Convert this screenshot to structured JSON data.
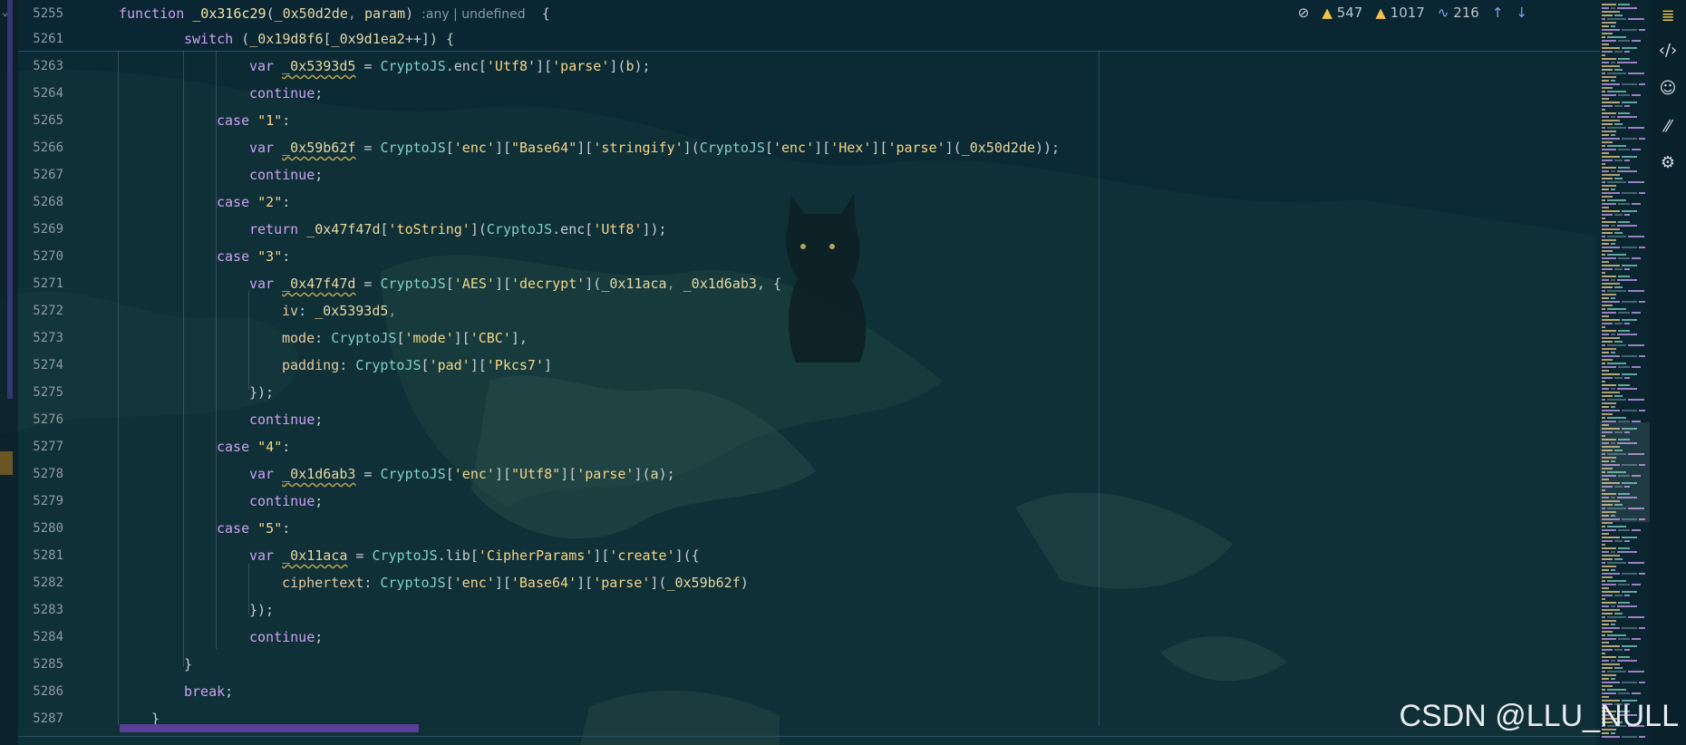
{
  "inlay": {
    "hidden_icon": "eye-off-icon",
    "warn1_count": "547",
    "warn2_count": "1017",
    "weak_count": "216"
  },
  "lines": [
    {
      "num": "5255",
      "tokens": [
        [
          "function ",
          "kw"
        ],
        [
          "_0x316c29",
          "fn"
        ],
        [
          "(",
          "pn"
        ],
        [
          "_0x50d2de",
          "id"
        ],
        [
          ", ",
          "cm"
        ],
        [
          "param",
          "id"
        ],
        [
          ") ",
          "pn"
        ],
        [
          ":any | undefined",
          "hint"
        ],
        [
          "  {",
          "pn"
        ]
      ]
    },
    {
      "num": "5261",
      "tokens": [
        [
          "switch ",
          "kw"
        ],
        [
          "(",
          "pn"
        ],
        [
          "_0x19d8f6",
          "id"
        ],
        [
          "[",
          "pn"
        ],
        [
          "_0x9d1ea2",
          "id"
        ],
        [
          "++",
          "pn"
        ],
        [
          "]) {",
          "pn"
        ]
      ]
    },
    {
      "num": "5263",
      "tokens": [
        [
          "var ",
          "kw"
        ],
        [
          "_0x5393d5",
          "id wavy"
        ],
        [
          " = ",
          "pn"
        ],
        [
          "CryptoJS",
          "obj"
        ],
        [
          ".enc[",
          "pn"
        ],
        [
          "'Utf8'",
          "str"
        ],
        [
          "][",
          "pn"
        ],
        [
          "'parse'",
          "str"
        ],
        [
          "](",
          "pn"
        ],
        [
          "b",
          "id"
        ],
        [
          ");",
          "pn"
        ]
      ]
    },
    {
      "num": "5264",
      "tokens": [
        [
          "continue",
          "kw"
        ],
        [
          ";",
          "pn"
        ]
      ]
    },
    {
      "num": "5265",
      "tokens": [
        [
          "case ",
          "kw"
        ],
        [
          "\"1\"",
          "str"
        ],
        [
          ":",
          "pn"
        ]
      ]
    },
    {
      "num": "5266",
      "tokens": [
        [
          "var ",
          "kw"
        ],
        [
          "_0x59b62f",
          "id wavy"
        ],
        [
          " = ",
          "pn"
        ],
        [
          "CryptoJS",
          "obj"
        ],
        [
          "[",
          "pn"
        ],
        [
          "'enc'",
          "str"
        ],
        [
          "][",
          "pn"
        ],
        [
          "\"Base64\"",
          "str"
        ],
        [
          "][",
          "pn"
        ],
        [
          "'stringify'",
          "str"
        ],
        [
          "](",
          "pn"
        ],
        [
          "CryptoJS",
          "obj"
        ],
        [
          "[",
          "pn"
        ],
        [
          "'enc'",
          "str"
        ],
        [
          "][",
          "pn"
        ],
        [
          "'Hex'",
          "str"
        ],
        [
          "][",
          "pn"
        ],
        [
          "'parse'",
          "str"
        ],
        [
          "](",
          "pn"
        ],
        [
          "_0x50d2de",
          "id"
        ],
        [
          "));",
          "pn"
        ]
      ]
    },
    {
      "num": "5267",
      "tokens": [
        [
          "continue",
          "kw"
        ],
        [
          ";",
          "pn"
        ]
      ]
    },
    {
      "num": "5268",
      "tokens": [
        [
          "case ",
          "kw"
        ],
        [
          "\"2\"",
          "str"
        ],
        [
          ":",
          "pn"
        ]
      ]
    },
    {
      "num": "5269",
      "tokens": [
        [
          "return ",
          "kw"
        ],
        [
          "_0x47f47d",
          "id"
        ],
        [
          "[",
          "pn"
        ],
        [
          "'toString'",
          "str"
        ],
        [
          "](",
          "pn"
        ],
        [
          "CryptoJS",
          "obj"
        ],
        [
          ".enc[",
          "pn"
        ],
        [
          "'Utf8'",
          "str"
        ],
        [
          "]);",
          "pn"
        ]
      ]
    },
    {
      "num": "5270",
      "tokens": [
        [
          "case ",
          "kw"
        ],
        [
          "\"3\"",
          "str"
        ],
        [
          ":",
          "pn"
        ]
      ]
    },
    {
      "num": "5271",
      "tokens": [
        [
          "var ",
          "kw"
        ],
        [
          "_0x47f47d",
          "id wavy"
        ],
        [
          " = ",
          "pn"
        ],
        [
          "CryptoJS",
          "obj"
        ],
        [
          "[",
          "pn"
        ],
        [
          "'AES'",
          "str"
        ],
        [
          "][",
          "pn"
        ],
        [
          "'decrypt'",
          "str"
        ],
        [
          "](",
          "pn"
        ],
        [
          "_0x11aca",
          "id"
        ],
        [
          ", ",
          "cm"
        ],
        [
          "_0x1d6ab3",
          "id"
        ],
        [
          ", {",
          "pn"
        ]
      ]
    },
    {
      "num": "5272",
      "tokens": [
        [
          "iv",
          "prop"
        ],
        [
          ": ",
          "pn"
        ],
        [
          "_0x5393d5",
          "id"
        ],
        [
          ",",
          "cm"
        ]
      ]
    },
    {
      "num": "5273",
      "tokens": [
        [
          "mode",
          "prop"
        ],
        [
          ": ",
          "pn"
        ],
        [
          "CryptoJS",
          "obj"
        ],
        [
          "[",
          "pn"
        ],
        [
          "'mode'",
          "str"
        ],
        [
          "][",
          "pn"
        ],
        [
          "'CBC'",
          "str"
        ],
        [
          "],",
          "pn"
        ]
      ]
    },
    {
      "num": "5274",
      "tokens": [
        [
          "padding",
          "prop"
        ],
        [
          ": ",
          "pn"
        ],
        [
          "CryptoJS",
          "obj"
        ],
        [
          "[",
          "pn"
        ],
        [
          "'pad'",
          "str"
        ],
        [
          "][",
          "pn"
        ],
        [
          "'Pkcs7'",
          "str"
        ],
        [
          "]",
          "pn"
        ]
      ]
    },
    {
      "num": "5275",
      "tokens": [
        [
          "});",
          "pn"
        ]
      ]
    },
    {
      "num": "5276",
      "tokens": [
        [
          "continue",
          "kw"
        ],
        [
          ";",
          "pn"
        ]
      ]
    },
    {
      "num": "5277",
      "tokens": [
        [
          "case ",
          "kw"
        ],
        [
          "\"4\"",
          "str"
        ],
        [
          ":",
          "pn"
        ]
      ]
    },
    {
      "num": "5278",
      "tokens": [
        [
          "var ",
          "kw"
        ],
        [
          "_0x1d6ab3",
          "id wavy"
        ],
        [
          " = ",
          "pn"
        ],
        [
          "CryptoJS",
          "obj"
        ],
        [
          "[",
          "pn"
        ],
        [
          "'enc'",
          "str"
        ],
        [
          "][",
          "pn"
        ],
        [
          "\"Utf8\"",
          "str"
        ],
        [
          "][",
          "pn"
        ],
        [
          "'parse'",
          "str"
        ],
        [
          "](",
          "pn"
        ],
        [
          "a",
          "id"
        ],
        [
          ");",
          "pn"
        ]
      ]
    },
    {
      "num": "5279",
      "tokens": [
        [
          "continue",
          "kw"
        ],
        [
          ";",
          "pn"
        ]
      ]
    },
    {
      "num": "5280",
      "tokens": [
        [
          "case ",
          "kw"
        ],
        [
          "\"5\"",
          "str"
        ],
        [
          ":",
          "pn"
        ]
      ]
    },
    {
      "num": "5281",
      "tokens": [
        [
          "var ",
          "kw"
        ],
        [
          "_0x11aca",
          "id wavy"
        ],
        [
          " = ",
          "pn"
        ],
        [
          "CryptoJS",
          "obj"
        ],
        [
          ".lib[",
          "pn"
        ],
        [
          "'CipherParams'",
          "str"
        ],
        [
          "][",
          "pn"
        ],
        [
          "'create'",
          "str"
        ],
        [
          "]({",
          "pn"
        ]
      ]
    },
    {
      "num": "5282",
      "tokens": [
        [
          "ciphertext",
          "prop"
        ],
        [
          ": ",
          "pn"
        ],
        [
          "CryptoJS",
          "obj"
        ],
        [
          "[",
          "pn"
        ],
        [
          "'enc'",
          "str"
        ],
        [
          "][",
          "pn"
        ],
        [
          "'Base64'",
          "str"
        ],
        [
          "][",
          "pn"
        ],
        [
          "'parse'",
          "str"
        ],
        [
          "](",
          "pn"
        ],
        [
          "_0x59b62f",
          "id"
        ],
        [
          ")",
          "pn"
        ]
      ]
    },
    {
      "num": "5283",
      "tokens": [
        [
          "});",
          "pn"
        ]
      ]
    },
    {
      "num": "5284",
      "tokens": [
        [
          "continue",
          "kw"
        ],
        [
          ";",
          "pn"
        ]
      ]
    },
    {
      "num": "5285",
      "tokens": [
        [
          "}",
          "pn"
        ]
      ]
    },
    {
      "num": "5286",
      "tokens": [
        [
          "break",
          "kw"
        ],
        [
          ";",
          "pn"
        ]
      ]
    },
    {
      "num": "5287",
      "tokens": [
        [
          "}",
          "pn"
        ]
      ]
    }
  ],
  "rail_icons": [
    "database-icon",
    "code-icon",
    "copilot-icon",
    "ai-assistant-icon",
    "bot-icon"
  ],
  "watermark": "CSDN @LLU_NULL"
}
